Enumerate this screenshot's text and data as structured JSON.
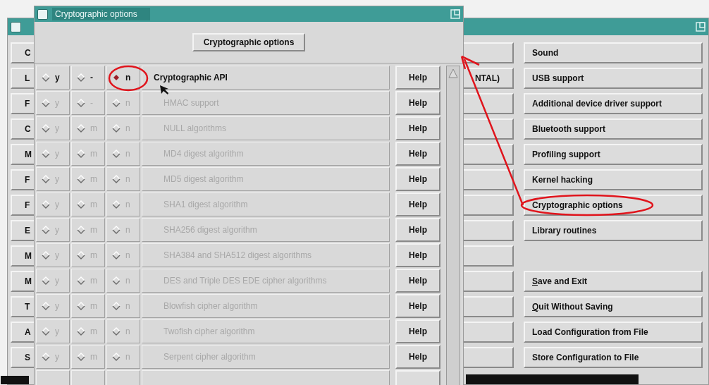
{
  "main_window": {
    "left_buttons": [
      {
        "label": "C"
      },
      {
        "label": "L"
      },
      {
        "label": "F"
      },
      {
        "label": "C"
      },
      {
        "label": "M"
      },
      {
        "label": "F"
      },
      {
        "label": "F"
      },
      {
        "label": "E"
      },
      {
        "label": "M"
      },
      {
        "label": "M"
      },
      {
        "label": "T"
      },
      {
        "label": "A"
      },
      {
        "label": "S"
      }
    ],
    "middle_buttons": [
      {
        "kind": "blank"
      },
      {
        "kind": "text",
        "label": "NTAL)"
      },
      {
        "kind": "blank"
      },
      {
        "kind": "blank"
      },
      {
        "kind": "blank"
      },
      {
        "kind": "blank"
      },
      {
        "kind": "blank"
      },
      {
        "kind": "blank"
      },
      {
        "kind": "blank"
      },
      {
        "kind": "blank"
      },
      {
        "kind": "blank"
      },
      {
        "kind": "blank"
      },
      {
        "kind": "blank"
      }
    ],
    "menu_buttons": [
      {
        "label": "Sound",
        "mnemonic": false
      },
      {
        "label": "USB support",
        "mnemonic": false
      },
      {
        "label": "Additional device driver support",
        "mnemonic": false
      },
      {
        "label": "Bluetooth support",
        "mnemonic": false
      },
      {
        "label": "Profiling support",
        "mnemonic": false
      },
      {
        "label": "Kernel hacking",
        "mnemonic": false
      },
      {
        "label": "Cryptographic options",
        "mnemonic": false
      },
      {
        "label": "Library routines",
        "mnemonic": false
      },
      {
        "kind": "gap"
      },
      {
        "label": "Save and Exit",
        "mnemonic": true
      },
      {
        "label": "Quit Without Saving",
        "mnemonic": true
      },
      {
        "label": "Load Configuration from File",
        "mnemonic": false
      },
      {
        "label": "Store Configuration to File",
        "mnemonic": false
      }
    ]
  },
  "dialog": {
    "title": "Cryptographic options",
    "header_button": "Cryptographic options",
    "options": [
      {
        "label": "Cryptographic API",
        "disabled": false,
        "help": "Help",
        "choices": [
          {
            "label": "y",
            "selected": false
          },
          {
            "label": "-",
            "selected": false
          },
          {
            "label": "n",
            "selected": true
          }
        ],
        "children": [
          {
            "label": "HMAC support",
            "disabled": true,
            "help": "Help",
            "choices": [
              {
                "label": "y",
                "selected": false
              },
              {
                "label": "-",
                "selected": false
              },
              {
                "label": "n",
                "selected": false
              }
            ]
          },
          {
            "label": "NULL algorithms",
            "disabled": true,
            "help": "Help",
            "choices": [
              {
                "label": "y",
                "selected": false
              },
              {
                "label": "m",
                "selected": false
              },
              {
                "label": "n",
                "selected": false
              }
            ]
          },
          {
            "label": "MD4 digest algorithm",
            "disabled": true,
            "help": "Help",
            "choices": [
              {
                "label": "y",
                "selected": false
              },
              {
                "label": "m",
                "selected": false
              },
              {
                "label": "n",
                "selected": false
              }
            ]
          },
          {
            "label": "MD5 digest algorithm",
            "disabled": true,
            "help": "Help",
            "choices": [
              {
                "label": "y",
                "selected": false
              },
              {
                "label": "m",
                "selected": false
              },
              {
                "label": "n",
                "selected": false
              }
            ]
          },
          {
            "label": "SHA1 digest algorithm",
            "disabled": true,
            "help": "Help",
            "choices": [
              {
                "label": "y",
                "selected": false
              },
              {
                "label": "m",
                "selected": false
              },
              {
                "label": "n",
                "selected": false
              }
            ]
          },
          {
            "label": "SHA256 digest algorithm",
            "disabled": true,
            "help": "Help",
            "choices": [
              {
                "label": "y",
                "selected": false
              },
              {
                "label": "m",
                "selected": false
              },
              {
                "label": "n",
                "selected": false
              }
            ]
          },
          {
            "label": "SHA384 and SHA512 digest algorithms",
            "disabled": true,
            "help": "Help",
            "choices": [
              {
                "label": "y",
                "selected": false
              },
              {
                "label": "m",
                "selected": false
              },
              {
                "label": "n",
                "selected": false
              }
            ]
          },
          {
            "label": "DES and Triple DES EDE cipher algorithms",
            "disabled": true,
            "help": "Help",
            "choices": [
              {
                "label": "y",
                "selected": false
              },
              {
                "label": "m",
                "selected": false
              },
              {
                "label": "n",
                "selected": false
              }
            ]
          },
          {
            "label": "Blowfish cipher algorithm",
            "disabled": true,
            "help": "Help",
            "choices": [
              {
                "label": "y",
                "selected": false
              },
              {
                "label": "m",
                "selected": false
              },
              {
                "label": "n",
                "selected": false
              }
            ]
          },
          {
            "label": "Twofish cipher algorithm",
            "disabled": true,
            "help": "Help",
            "choices": [
              {
                "label": "y",
                "selected": false
              },
              {
                "label": "m",
                "selected": false
              },
              {
                "label": "n",
                "selected": false
              }
            ]
          },
          {
            "label": "Serpent cipher algorithm",
            "disabled": true,
            "help": "Help",
            "choices": [
              {
                "label": "y",
                "selected": false
              },
              {
                "label": "m",
                "selected": false
              },
              {
                "label": "n",
                "selected": false
              }
            ]
          }
        ]
      }
    ]
  }
}
